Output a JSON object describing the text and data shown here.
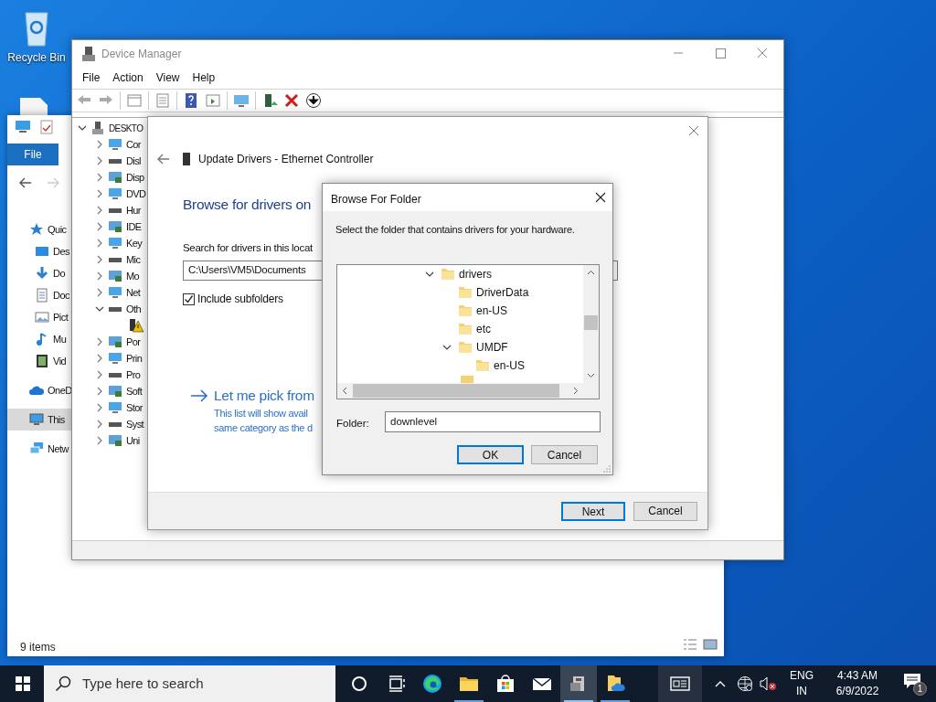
{
  "desktop": {
    "icons": [
      {
        "label": "Recycle Bin"
      }
    ]
  },
  "explorer": {
    "file_tab": "File",
    "nav": [
      {
        "label": "Quic",
        "kind": "star",
        "selected": false,
        "children": [
          {
            "label": "Des",
            "kind": "desktop",
            "selected": false
          },
          {
            "label": "Do",
            "kind": "download",
            "selected": false
          },
          {
            "label": "Doc",
            "kind": "document",
            "selected": false
          },
          {
            "label": "Pict",
            "kind": "pictures",
            "selected": false
          },
          {
            "label": "Mu",
            "kind": "music",
            "selected": false
          },
          {
            "label": "Vid",
            "kind": "video",
            "selected": false
          }
        ]
      },
      {
        "label": "OneD",
        "kind": "cloud",
        "selected": false
      },
      {
        "label": "This",
        "kind": "pc",
        "selected": true
      },
      {
        "label": "Netw",
        "kind": "network",
        "selected": false
      }
    ],
    "status": "9 items"
  },
  "device_manager": {
    "title": "Device Manager",
    "menu": [
      "File",
      "Action",
      "View",
      "Help"
    ],
    "tree": {
      "label": "DESKTO",
      "expanded": true,
      "children": [
        {
          "label": "Cor",
          "expanded": false
        },
        {
          "label": "Disl",
          "expanded": false
        },
        {
          "label": "Disp",
          "expanded": false
        },
        {
          "label": "DVD",
          "expanded": false
        },
        {
          "label": "Hur",
          "expanded": false
        },
        {
          "label": "IDE",
          "expanded": false
        },
        {
          "label": "Key",
          "expanded": false
        },
        {
          "label": "Mic",
          "expanded": false
        },
        {
          "label": "Mo",
          "expanded": false
        },
        {
          "label": "Net",
          "expanded": false
        },
        {
          "label": "Oth",
          "expanded": true,
          "children": [
            {
              "kind": "warning-device"
            }
          ]
        },
        {
          "label": "Por",
          "expanded": false
        },
        {
          "label": "Prin",
          "expanded": false
        },
        {
          "label": "Pro",
          "expanded": false
        },
        {
          "label": "Soft",
          "expanded": false
        },
        {
          "label": "Stor",
          "expanded": false
        },
        {
          "label": "Syst",
          "expanded": false
        },
        {
          "label": "Uni",
          "expanded": false
        }
      ]
    }
  },
  "update_dialog": {
    "title": "Update Drivers - Ethernet Controller",
    "heading": "Browse for drivers on",
    "search_label": "Search for drivers in this locat",
    "path": "C:\\Users\\VM5\\Documents",
    "include_subfolders": {
      "label": "Include subfolders",
      "checked": true
    },
    "link": {
      "title": "Let me pick from",
      "lines": [
        "This list will show avail",
        "same category as the d"
      ]
    },
    "buttons": [
      {
        "label": "Next",
        "default": true
      },
      {
        "label": "Cancel",
        "default": false
      }
    ]
  },
  "browse_dialog": {
    "title": "Browse For Folder",
    "prompt": "Select the folder that contains drivers for your hardware.",
    "tree": [
      {
        "label": "drivers",
        "expanded": true,
        "children": [
          {
            "label": "DriverData"
          },
          {
            "label": "en-US"
          },
          {
            "label": "etc"
          },
          {
            "label": "UMDF",
            "expanded": true,
            "children": [
              {
                "label": "en-US"
              }
            ]
          }
        ]
      }
    ],
    "folder_label": "Folder:",
    "folder_value": "downlevel",
    "buttons": [
      {
        "label": "OK",
        "default": true
      },
      {
        "label": "Cancel",
        "default": false
      }
    ]
  },
  "taskbar": {
    "search_placeholder": "Type here to search",
    "apps": [
      {
        "kind": "cortana",
        "running": false,
        "active": false
      },
      {
        "kind": "taskview",
        "running": false,
        "active": false
      },
      {
        "kind": "edge",
        "running": false,
        "active": false
      },
      {
        "kind": "explorer",
        "running": true,
        "active": false
      },
      {
        "kind": "store",
        "running": false,
        "active": false
      },
      {
        "kind": "mail",
        "running": false,
        "active": false
      },
      {
        "kind": "devmgr",
        "running": true,
        "active": true
      },
      {
        "kind": "onedrive-folder",
        "running": true,
        "active": false
      }
    ],
    "tray": {
      "language": [
        "ENG",
        "IN"
      ],
      "time": "4:43 AM",
      "date": "6/9/2022",
      "notifications": "1"
    }
  }
}
